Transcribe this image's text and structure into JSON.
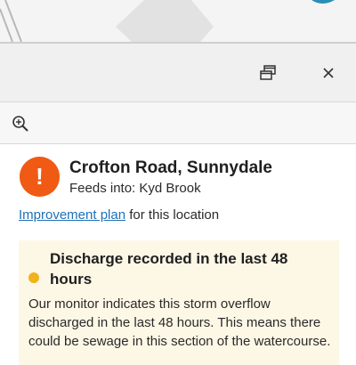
{
  "panel": {
    "expand_icon": "window-restore-icon",
    "close_icon": "close-icon",
    "zoom_icon": "zoom-in-icon"
  },
  "location": {
    "status_symbol": "!",
    "status_color": "#f05a14",
    "title": "Crofton Road, Sunnydale",
    "feeds_into": "Feeds into: Kyd Brook"
  },
  "plan": {
    "link_text": "Improvement plan",
    "suffix_text": " for this location"
  },
  "alert": {
    "dot_color": "#f2b21a",
    "title": "Discharge recorded in the last 48 hours",
    "body": "Our monitor indicates this storm overflow discharged in the last 48 hours. This means there could be sewage in this section of the watercourse."
  }
}
